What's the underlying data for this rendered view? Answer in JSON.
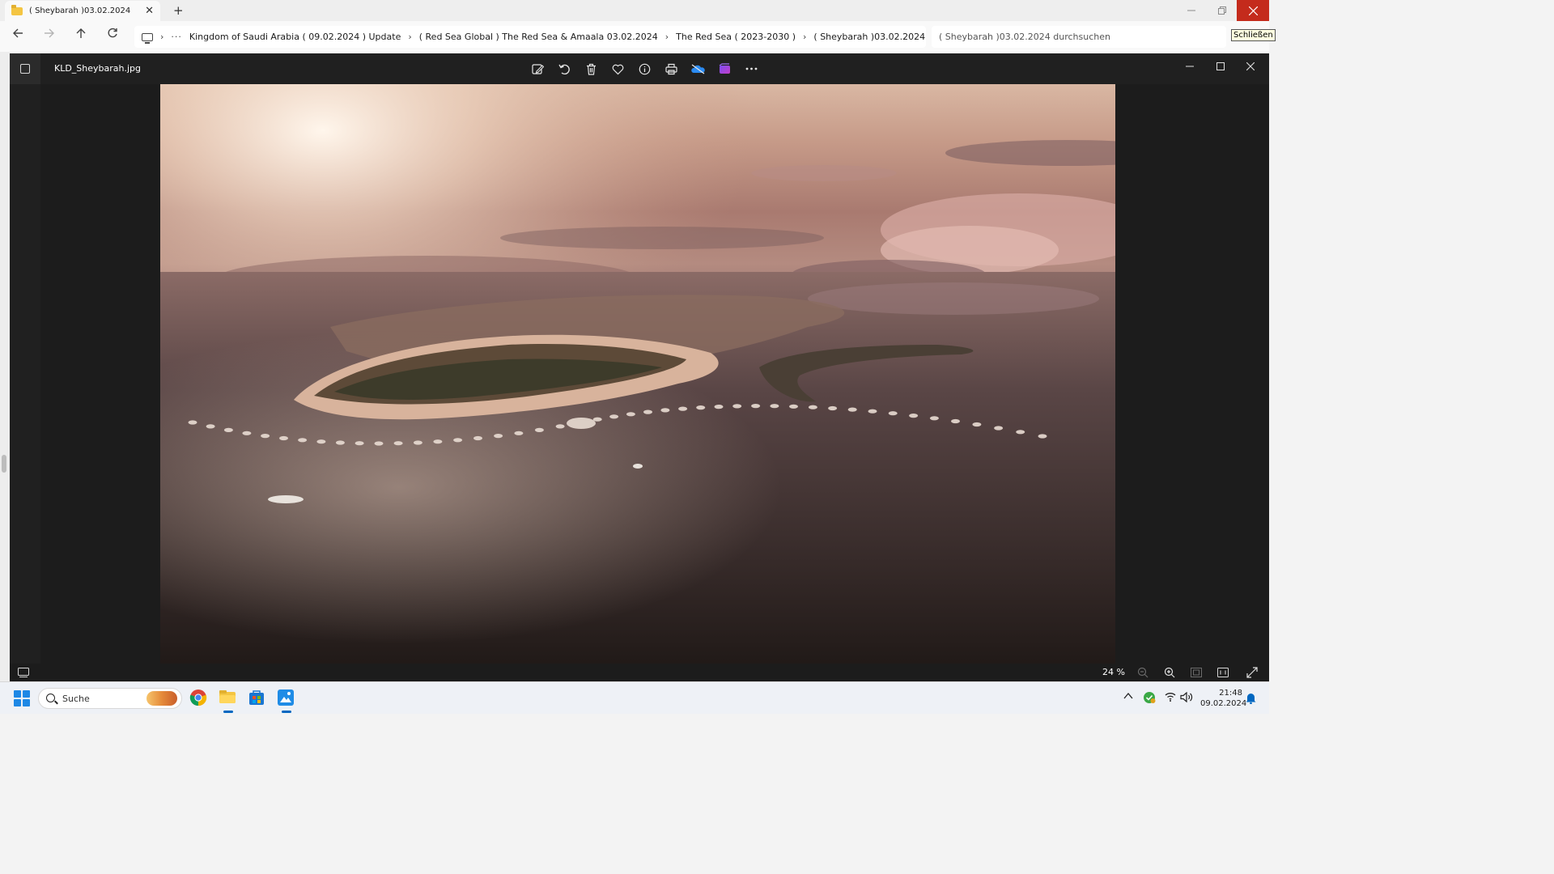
{
  "explorer": {
    "tab_title": "( Sheybarah )03.02.2024",
    "tab_close": "✕",
    "new_tab": "+",
    "breadcrumbs": [
      "Kingdom of Saudi Arabia ( 09.02.2024 ) Update",
      "( Red Sea Global ) The Red Sea & Amaala 03.02.2024",
      "The Red Sea ( 2023-2030 )",
      "( Sheybarah )03.02.2024"
    ],
    "breadcrumb_overflow": "···",
    "search_placeholder": "( Sheybarah )03.02.2024 durchsuchen",
    "close_tooltip": "Schließen"
  },
  "photos_viewer": {
    "file_name": "KLD_Sheybarah.jpg",
    "toolbar_icons": [
      "edit-image-icon",
      "rotate-icon",
      "delete-icon",
      "favorite-icon",
      "info-icon",
      "print-icon",
      "onedrive-icon",
      "clipchamp-icon",
      "more-icon"
    ],
    "zoom_level": "24 %"
  },
  "taskbar": {
    "search_label": "Suche",
    "apps": [
      "windows-start-icon",
      "chrome-icon",
      "file-explorer-icon",
      "microsoft-store-icon",
      "photos-icon"
    ],
    "time": "21:48",
    "date": "09.02.2024"
  },
  "colors": {
    "close_red": "#c42b1c",
    "viewer_bg": "#1c1c1c",
    "accent": "#0067c0"
  }
}
